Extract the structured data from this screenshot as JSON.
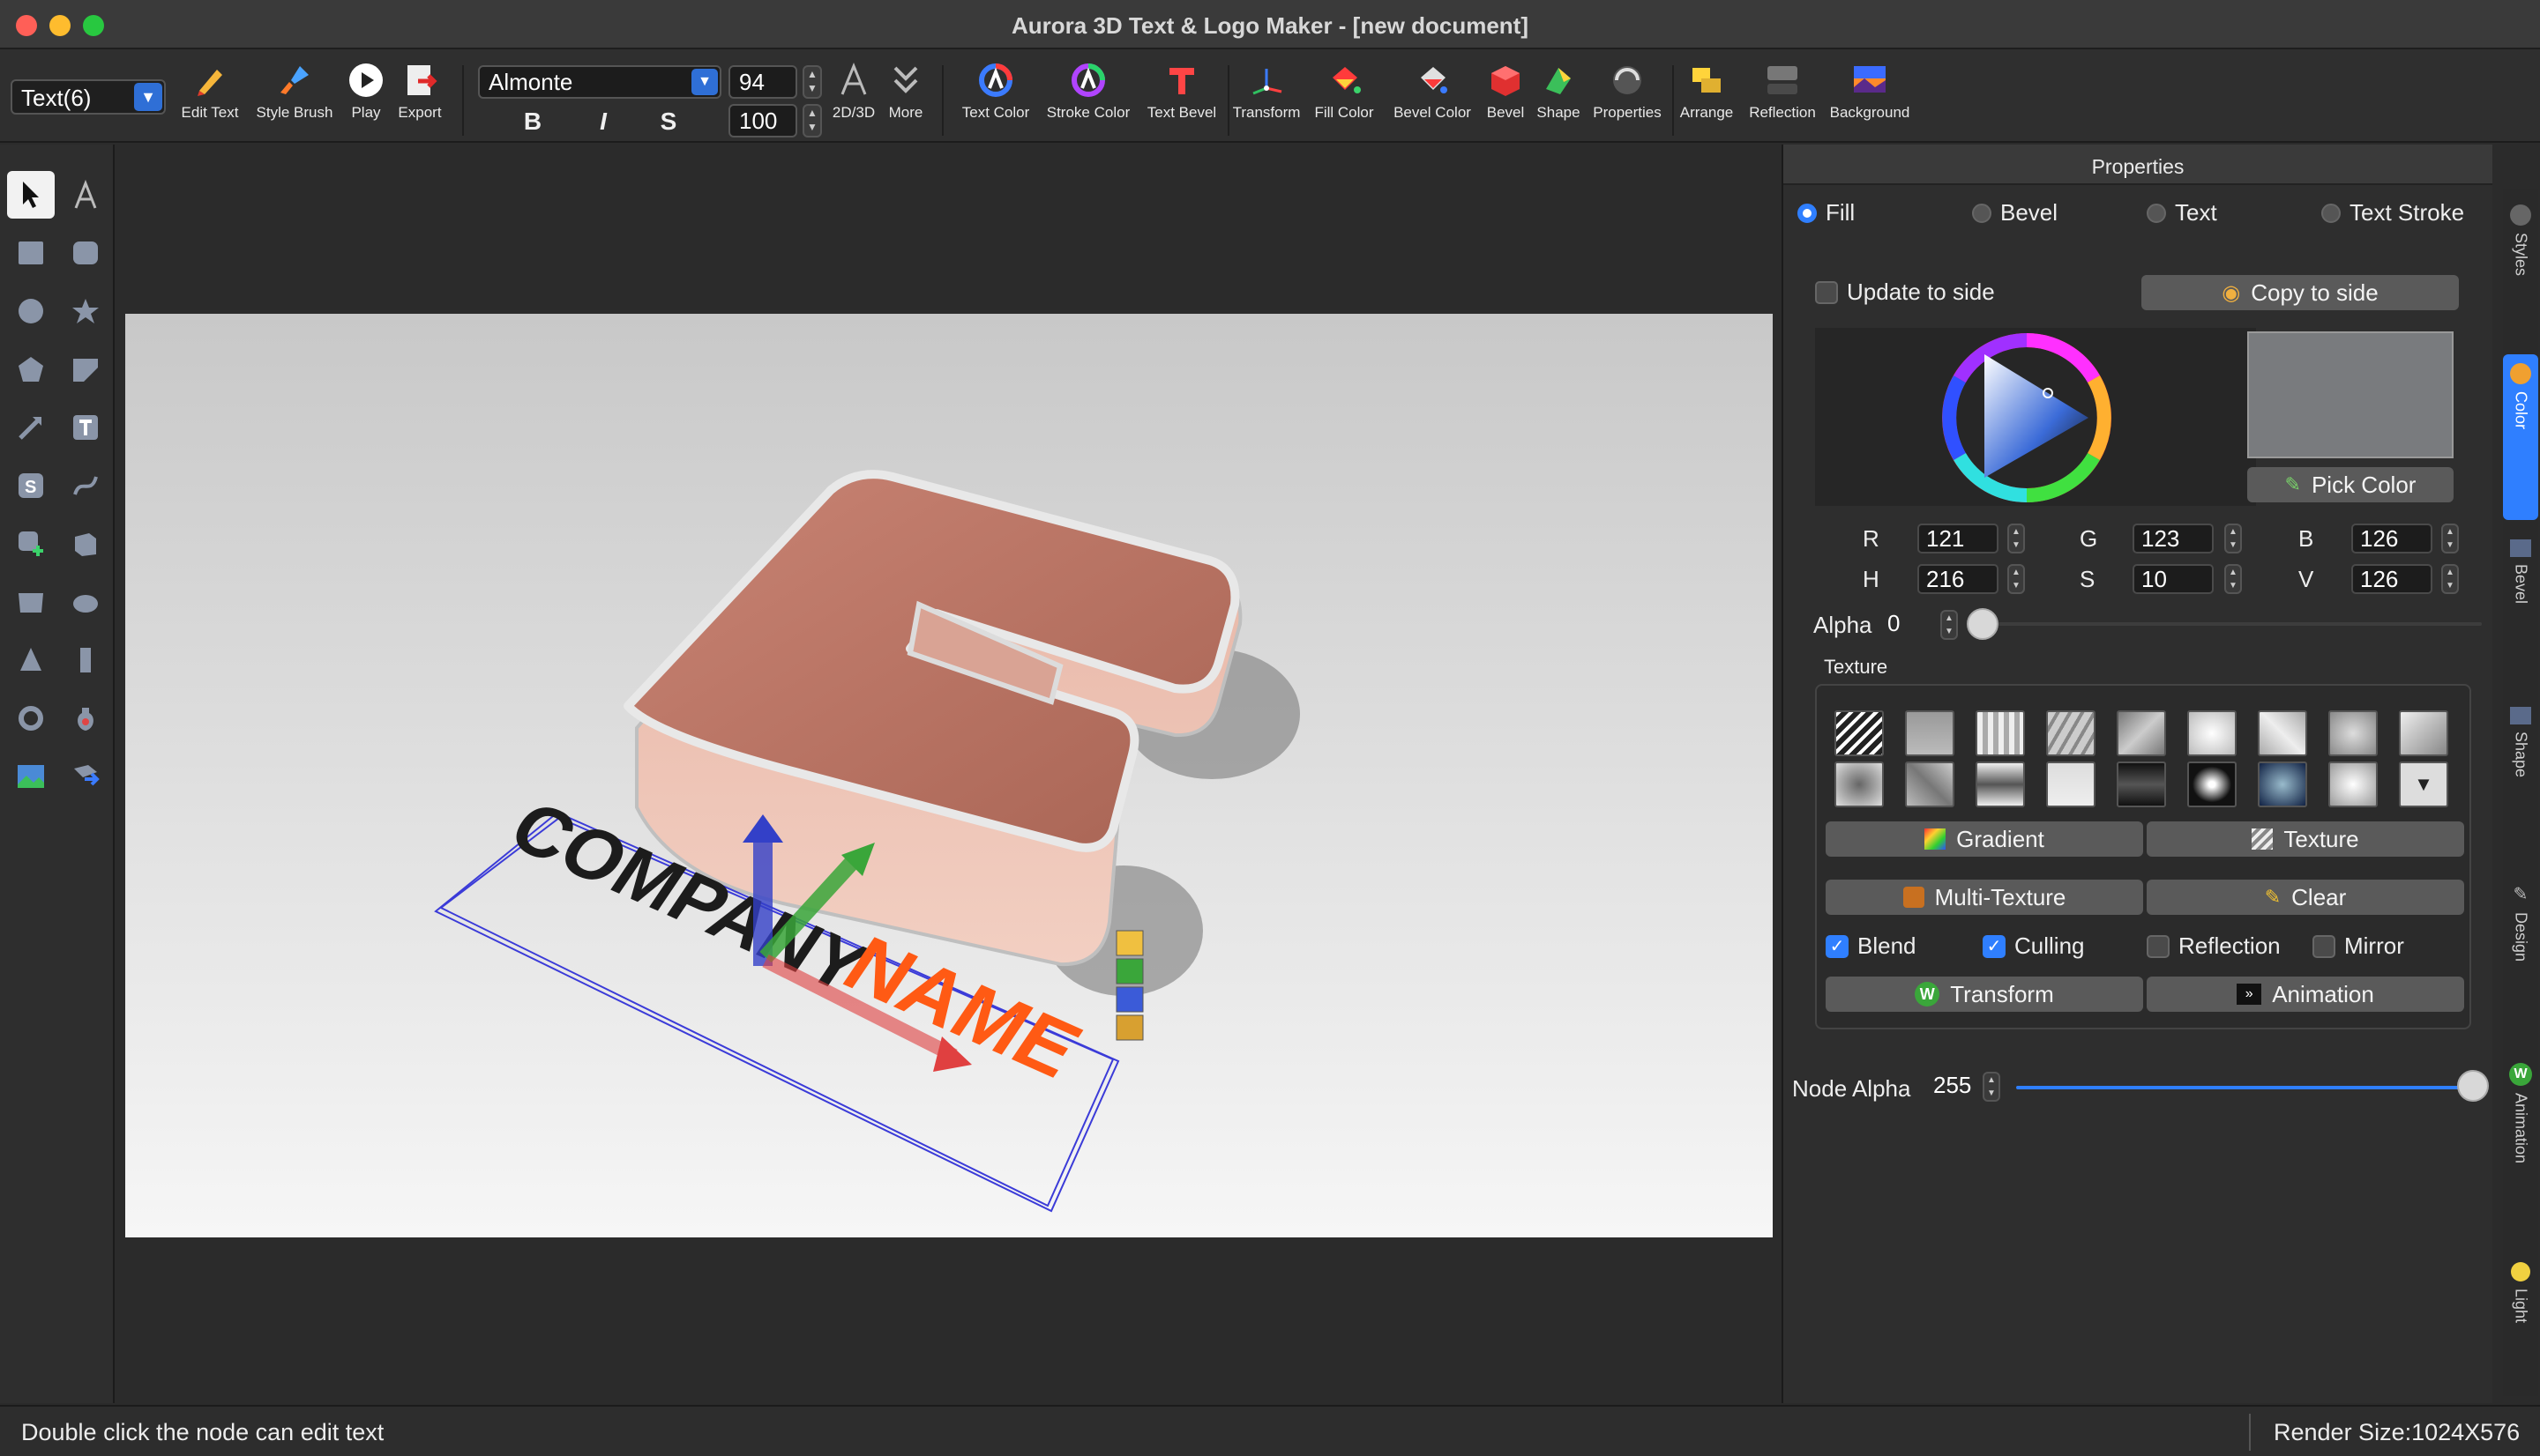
{
  "window": {
    "title": "Aurora 3D Text & Logo Maker - [new document]"
  },
  "toolbar": {
    "node_select": "Text(6)",
    "edit_text": "Edit Text",
    "style_brush": "Style Brush",
    "play": "Play",
    "export": "Export",
    "font": "Almonte",
    "size": "94",
    "scale": "100",
    "bold": "B",
    "italic": "I",
    "strike": "S",
    "mode_2d3d": "2D/3D",
    "more": "More",
    "text_color": "Text Color",
    "stroke_color": "Stroke Color",
    "text_bevel": "Text Bevel",
    "transform": "Transform",
    "fill_color": "Fill Color",
    "bevel_color": "Bevel Color",
    "bevel": "Bevel",
    "shape": "Shape",
    "properties": "Properties",
    "arrange": "Arrange",
    "reflection": "Reflection",
    "background": "Background"
  },
  "canvas": {
    "text_part1": "COMPANY",
    "text_part2": "NAME"
  },
  "properties": {
    "header": "Properties",
    "radio_fill": "Fill",
    "radio_bevel": "Bevel",
    "radio_text": "Text",
    "radio_text_stroke": "Text Stroke",
    "update_to_side": "Update to side",
    "copy_to_side": "Copy to side",
    "pick_color": "Pick Color",
    "r_label": "R",
    "r_value": "121",
    "g_label": "G",
    "g_value": "123",
    "b_label": "B",
    "b_value": "126",
    "h_label": "H",
    "h_value": "216",
    "s_label": "S",
    "s_value": "10",
    "v_label": "V",
    "v_value": "126",
    "alpha_label": "Alpha",
    "alpha_value": "0",
    "texture_label": "Texture",
    "gradient": "Gradient",
    "texture": "Texture",
    "multi_texture": "Multi-Texture",
    "clear": "Clear",
    "blend": "Blend",
    "culling": "Culling",
    "reflection": "Reflection",
    "mirror": "Mirror",
    "transform": "Transform",
    "animation": "Animation",
    "node_alpha_label": "Node Alpha",
    "node_alpha_value": "255"
  },
  "side_tabs": [
    "Styles",
    "Color",
    "Bevel",
    "Shape",
    "Design",
    "Animation",
    "Light"
  ],
  "status": {
    "hint": "Double click the node can edit text",
    "render_size": "Render Size:1024X576"
  },
  "colors": {
    "accent": "#2f7fff",
    "swatch": "#797b7e",
    "shape_tint": "#d9988a",
    "name_text": "#ff5a14"
  }
}
